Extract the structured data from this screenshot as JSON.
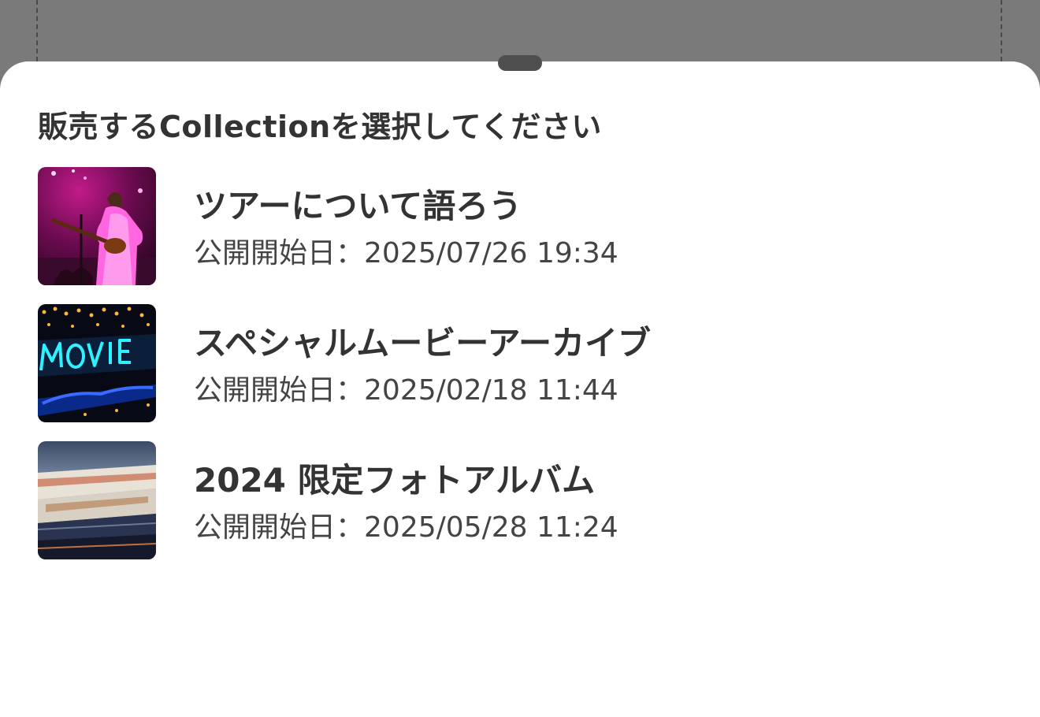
{
  "sheet": {
    "title": "販売するCollectionを選択してください"
  },
  "collections": [
    {
      "title": "ツアーについて語ろう",
      "date_prefix": "公開開始日：",
      "date": "2025/07/26 19:34",
      "thumbnail": "concert-photo"
    },
    {
      "title": "スペシャルムービーアーカイブ",
      "date_prefix": "公開開始日：",
      "date": "2025/02/18 11:44",
      "thumbnail": "neon-movie-sign"
    },
    {
      "title": "2024 限定フォトアルバム",
      "date_prefix": "公開開始日：",
      "date": "2025/05/28 11:24",
      "thumbnail": "photo-stack"
    }
  ],
  "colors": {
    "backdrop": "#7a7a7a",
    "sheet": "#ffffff",
    "text_primary": "#333333",
    "text_secondary": "#444444"
  }
}
